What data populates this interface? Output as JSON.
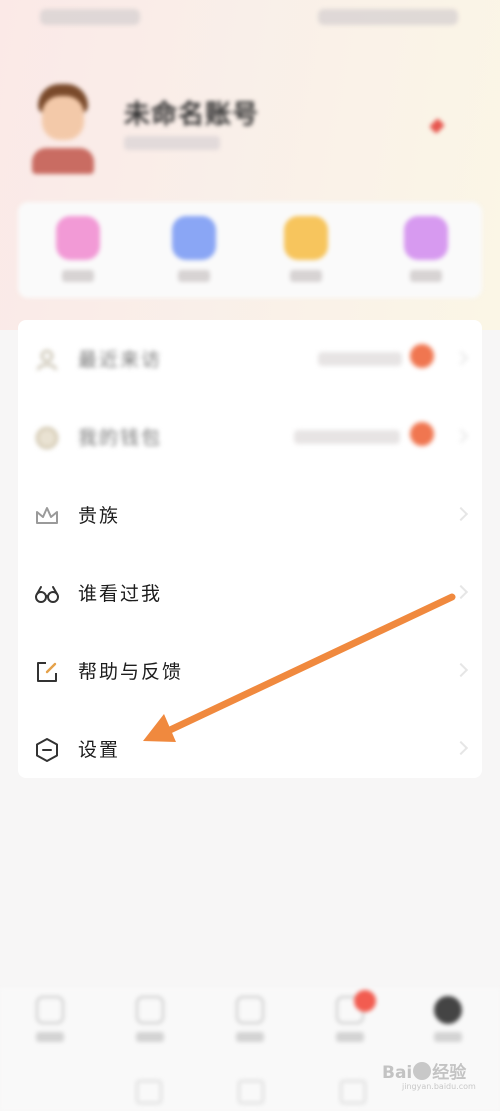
{
  "profile": {
    "name": "未命名账号"
  },
  "quick_actions": [
    {
      "icon": "heart-icon",
      "color": "#f29ad6"
    },
    {
      "icon": "chat-icon",
      "color": "#8aa6f5"
    },
    {
      "icon": "smile-icon",
      "color": "#f7c55d"
    },
    {
      "icon": "gift-icon",
      "color": "#d79af0"
    }
  ],
  "menu": {
    "items": [
      {
        "label": "最近来访",
        "icon": "visitor-icon",
        "blurred": true
      },
      {
        "label": "我的钱包",
        "icon": "wallet-icon",
        "blurred": true
      },
      {
        "label": "贵族",
        "icon": "crown-icon"
      },
      {
        "label": "谁看过我",
        "icon": "glasses-icon"
      },
      {
        "label": "帮助与反馈",
        "icon": "edit-icon"
      },
      {
        "label": "设置",
        "icon": "settings-icon"
      }
    ]
  },
  "annotation": {
    "color": "#f0893e",
    "target": "设置"
  },
  "tabbar": {
    "tabs": [
      "home-tab",
      "moments-tab",
      "discover-tab",
      "messages-tab",
      "me-tab"
    ]
  },
  "watermark": {
    "text": "Bai",
    "text2": "经验",
    "sub": "jingyan.baidu.com"
  }
}
